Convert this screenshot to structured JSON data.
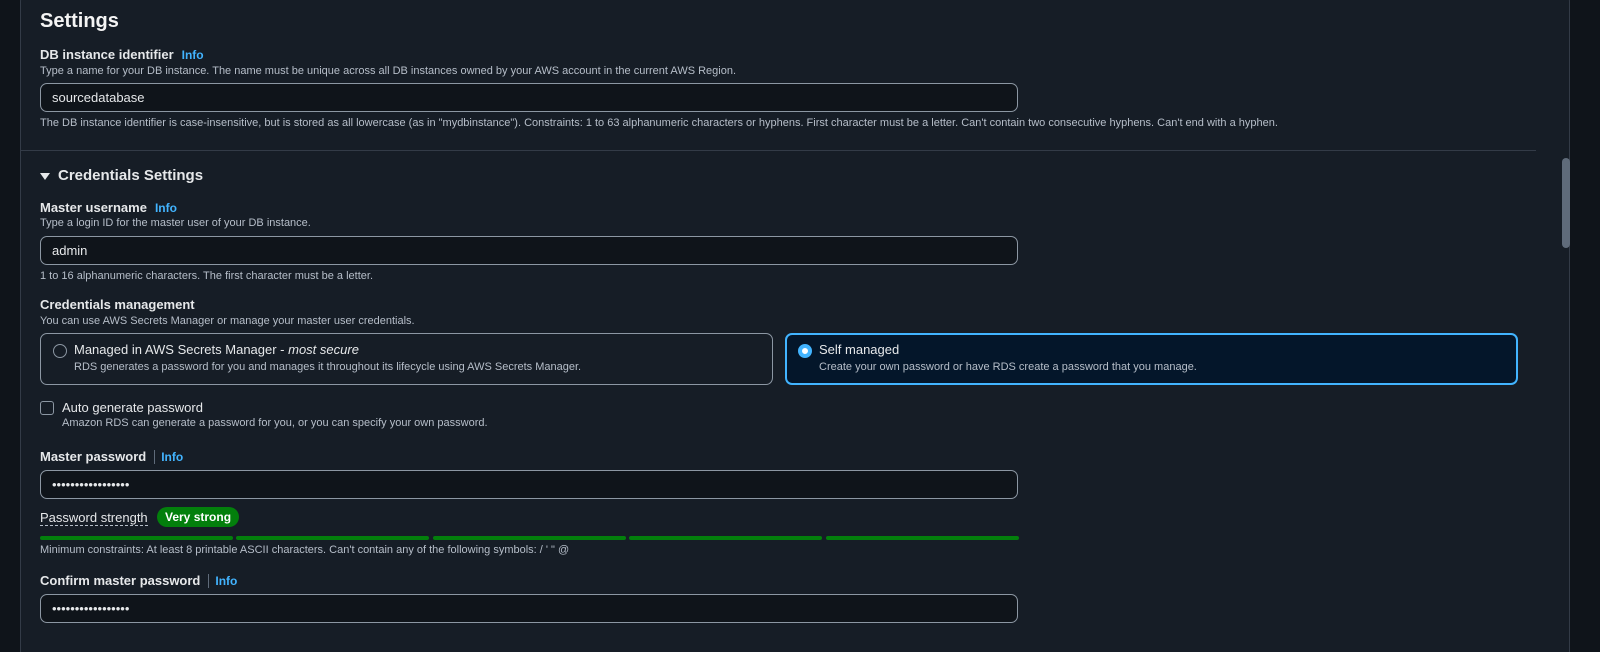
{
  "settings": {
    "heading": "Settings",
    "db_instance": {
      "label": "DB instance identifier",
      "info": "Info",
      "description": "Type a name for your DB instance. The name must be unique across all DB instances owned by your AWS account in the current AWS Region.",
      "value": "sourcedatabase",
      "constraint": "The DB instance identifier is case-insensitive, but is stored as all lowercase (as in \"mydbinstance\"). Constraints: 1 to 63 alphanumeric characters or hyphens. First character must be a letter. Can't contain two consecutive hyphens. Can't end with a hyphen."
    }
  },
  "credentials": {
    "heading": "Credentials Settings",
    "master_username": {
      "label": "Master username",
      "info": "Info",
      "description": "Type a login ID for the master user of your DB instance.",
      "value": "admin",
      "constraint": "1 to 16 alphanumeric characters. The first character must be a letter."
    },
    "management": {
      "label": "Credentials management",
      "description": "You can use AWS Secrets Manager or manage your master user credentials.",
      "options": [
        {
          "title": "Managed in AWS Secrets Manager - ",
          "title_emphasis": "most secure",
          "description": "RDS generates a password for you and manages it throughout its lifecycle using AWS Secrets Manager.",
          "selected": false
        },
        {
          "title": "Self managed",
          "description": "Create your own password or have RDS create a password that you manage.",
          "selected": true
        }
      ]
    },
    "auto_generate": {
      "label": "Auto generate password",
      "description": "Amazon RDS can generate a password for you, or you can specify your own password.",
      "checked": false
    },
    "master_password": {
      "label": "Master password",
      "info": "Info",
      "value": "•••••••••••••••••"
    },
    "strength": {
      "label": "Password strength",
      "badge": "Very strong",
      "segments_filled": 5,
      "segments_total": 5,
      "color": "#037f0c",
      "constraint": "Minimum constraints: At least 8 printable ASCII characters. Can't contain any of the following symbols: / ' \" @"
    },
    "confirm_password": {
      "label": "Confirm master password",
      "info": "Info",
      "value": "•••••••••••••••••"
    }
  },
  "colors": {
    "accent": "#42b4ff",
    "success": "#037f0c",
    "panel_bg": "#161d26"
  }
}
